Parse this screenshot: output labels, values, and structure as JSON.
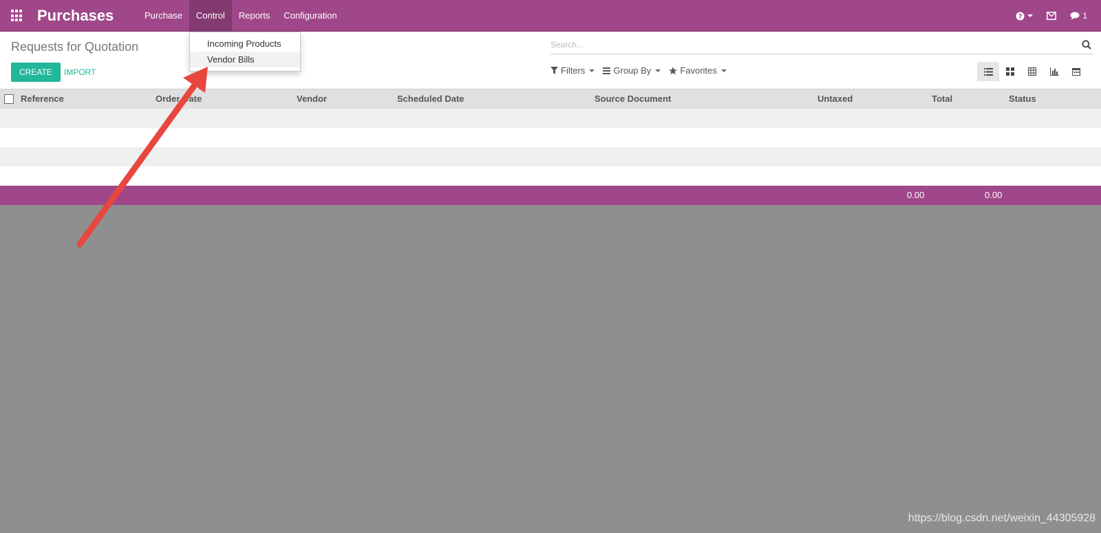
{
  "navbar": {
    "brand": "Purchases",
    "menu": [
      {
        "label": "Purchase"
      },
      {
        "label": "Control"
      },
      {
        "label": "Reports"
      },
      {
        "label": "Configuration"
      }
    ],
    "right": {
      "help_icon": "question-circle-icon",
      "mail_icon": "envelope-icon",
      "chat_icon": "comment-icon",
      "chat_count": "1"
    },
    "color": "#a0478a"
  },
  "control_dropdown": {
    "items": [
      {
        "label": "Incoming Products"
      },
      {
        "label": "Vendor Bills"
      }
    ]
  },
  "control_panel": {
    "title": "Requests for Quotation",
    "create_label": "CREATE",
    "import_label": "IMPORT",
    "search_placeholder": "Search...",
    "filters_label": "Filters",
    "groupby_label": "Group By",
    "favorites_label": "Favorites",
    "views": [
      "list-icon",
      "kanban-icon",
      "pivot-icon",
      "graph-icon",
      "calendar-icon"
    ],
    "accent": "#21b799"
  },
  "table": {
    "columns": [
      "Reference",
      "Order Date",
      "Vendor",
      "Scheduled Date",
      "Source Document",
      "Untaxed",
      "Total",
      "Status"
    ],
    "footer": {
      "untaxed_total": "0.00",
      "total": "0.00"
    }
  },
  "watermark": "https://blog.csdn.net/weixin_44305928"
}
